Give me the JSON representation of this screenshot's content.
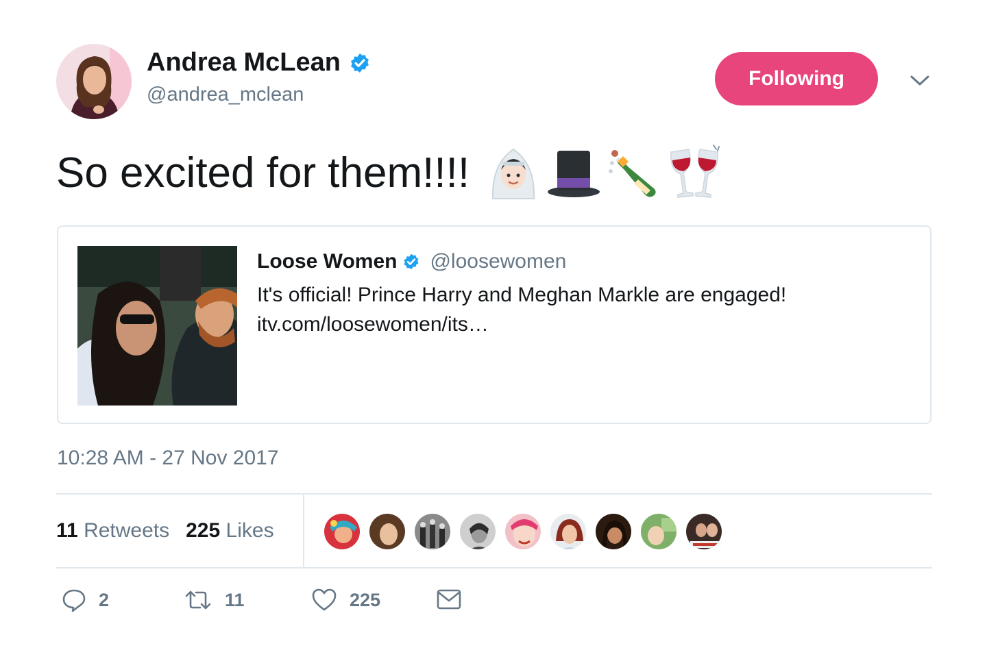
{
  "author": {
    "name": "Andrea McLean",
    "handle": "@andrea_mclean",
    "avatar_icon": "person-photo-icon"
  },
  "follow_button": {
    "label": "Following",
    "color": "#e8457c"
  },
  "tweet": {
    "text": "So excited for them!!!!",
    "emojis": [
      "bride-with-veil-emoji",
      "top-hat-emoji",
      "champagne-bottle-emoji",
      "clinking-glasses-emoji"
    ]
  },
  "quoted": {
    "name": "Loose Women",
    "handle": "@loosewomen",
    "text_line1": "It's official! Prince Harry and Meghan Markle are engaged!",
    "text_line2": "itv.com/loosewomen/its…"
  },
  "timestamp": "10:28 AM - 27 Nov 2017",
  "stats": {
    "retweets_count": "11",
    "retweets_label": "Retweets",
    "likes_count": "225",
    "likes_label": "Likes",
    "liker_count": 9
  },
  "actions": {
    "reply_count": "2",
    "retweet_count": "11",
    "like_count": "225"
  },
  "colors": {
    "verified": "#1da1f2",
    "secondary_text": "#657786",
    "border": "#e1e8ed"
  }
}
